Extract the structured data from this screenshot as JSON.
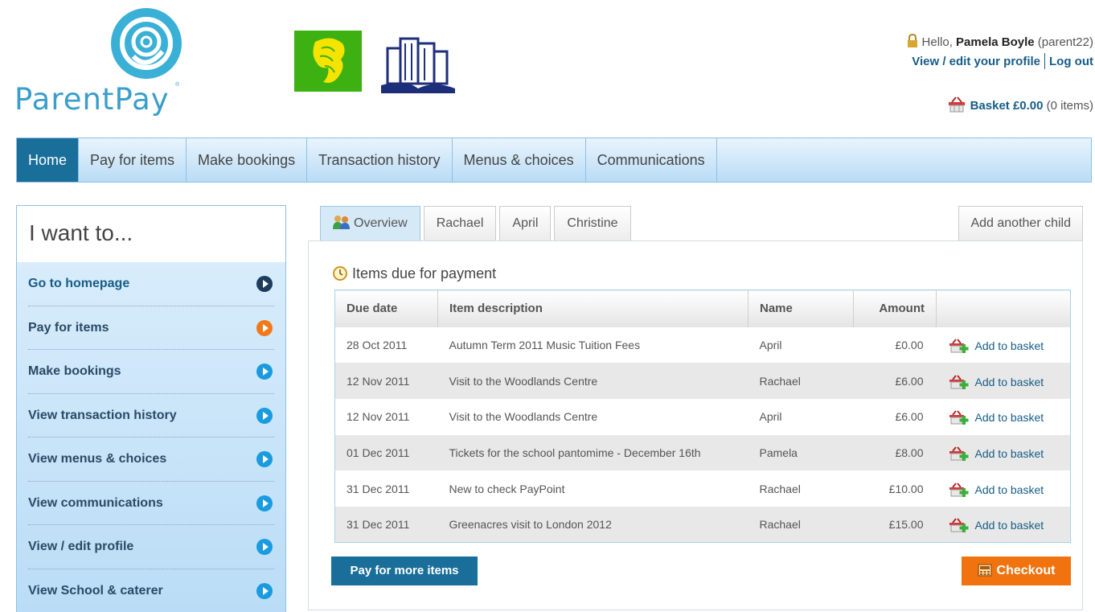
{
  "brand": {
    "name": "ParentPay",
    "registered": "®",
    "accent": "#3a9ecb",
    "icons": [
      "parentpay-logo-icon",
      "school-lion-crest-icon",
      "school-castle-crest-icon"
    ]
  },
  "user": {
    "greeting": "Hello, ",
    "name": "Pamela Boyle",
    "username": "(parent22)",
    "profile_link": "View / edit your profile",
    "logout_link": "Log out",
    "icon": "lock-icon"
  },
  "basket": {
    "label": "Basket £0.00",
    "count": "(0 items)",
    "icon": "basket-icon"
  },
  "nav": {
    "items": [
      {
        "label": "Home",
        "active": true
      },
      {
        "label": "Pay for items"
      },
      {
        "label": "Make bookings"
      },
      {
        "label": "Transaction history"
      },
      {
        "label": "Menus & choices"
      },
      {
        "label": "Communications"
      }
    ],
    "active_color": "#1a6e9a"
  },
  "sidebar": {
    "title": "I want to...",
    "items": [
      {
        "label": "Go to homepage",
        "arrow_color": "#1d3c5e"
      },
      {
        "label": "Pay for items",
        "arrow_color": "#f07a1a"
      },
      {
        "label": "Make bookings",
        "arrow_color": "#1a9be0"
      },
      {
        "label": "View transaction history",
        "arrow_color": "#1a9be0"
      },
      {
        "label": "View menus & choices",
        "arrow_color": "#1a9be0"
      },
      {
        "label": "View communications",
        "arrow_color": "#1a9be0"
      },
      {
        "label": "View / edit profile",
        "arrow_color": "#1a9be0"
      },
      {
        "label": "View School & caterer",
        "arrow_color": "#1a9be0"
      }
    ]
  },
  "tabs": {
    "items": [
      {
        "label": "Overview",
        "active": true,
        "icon": "family-icon"
      },
      {
        "label": "Rachael"
      },
      {
        "label": "April"
      },
      {
        "label": "Christine"
      }
    ],
    "add_child": "Add another child"
  },
  "payments": {
    "title": "Items due for payment",
    "icon": "clock-icon",
    "columns": [
      "Due date",
      "Item description",
      "Name",
      "Amount"
    ],
    "add_label": "Add to basket",
    "rows": [
      {
        "due": "28 Oct 2011",
        "description": "Autumn Term 2011 Music Tuition Fees",
        "name": "April",
        "amount": "£0.00"
      },
      {
        "due": "12 Nov 2011",
        "description": "Visit to the Woodlands Centre",
        "name": "Rachael",
        "amount": "£6.00"
      },
      {
        "due": "12 Nov 2011",
        "description": "Visit to the Woodlands Centre",
        "name": "April",
        "amount": "£6.00"
      },
      {
        "due": "01 Dec 2011",
        "description": "Tickets for the school pantomime - December 16th",
        "name": "Pamela",
        "amount": "£8.00"
      },
      {
        "due": "31 Dec 2011",
        "description": "New to check PayPoint",
        "name": "Rachael",
        "amount": "£10.00"
      },
      {
        "due": "31 Dec 2011",
        "description": "Greenacres visit to London 2012",
        "name": "Rachael",
        "amount": "£15.00"
      }
    ]
  },
  "actions": {
    "pay_more": "Pay for more items",
    "checkout": "Checkout",
    "checkout_color": "#f0730f"
  }
}
